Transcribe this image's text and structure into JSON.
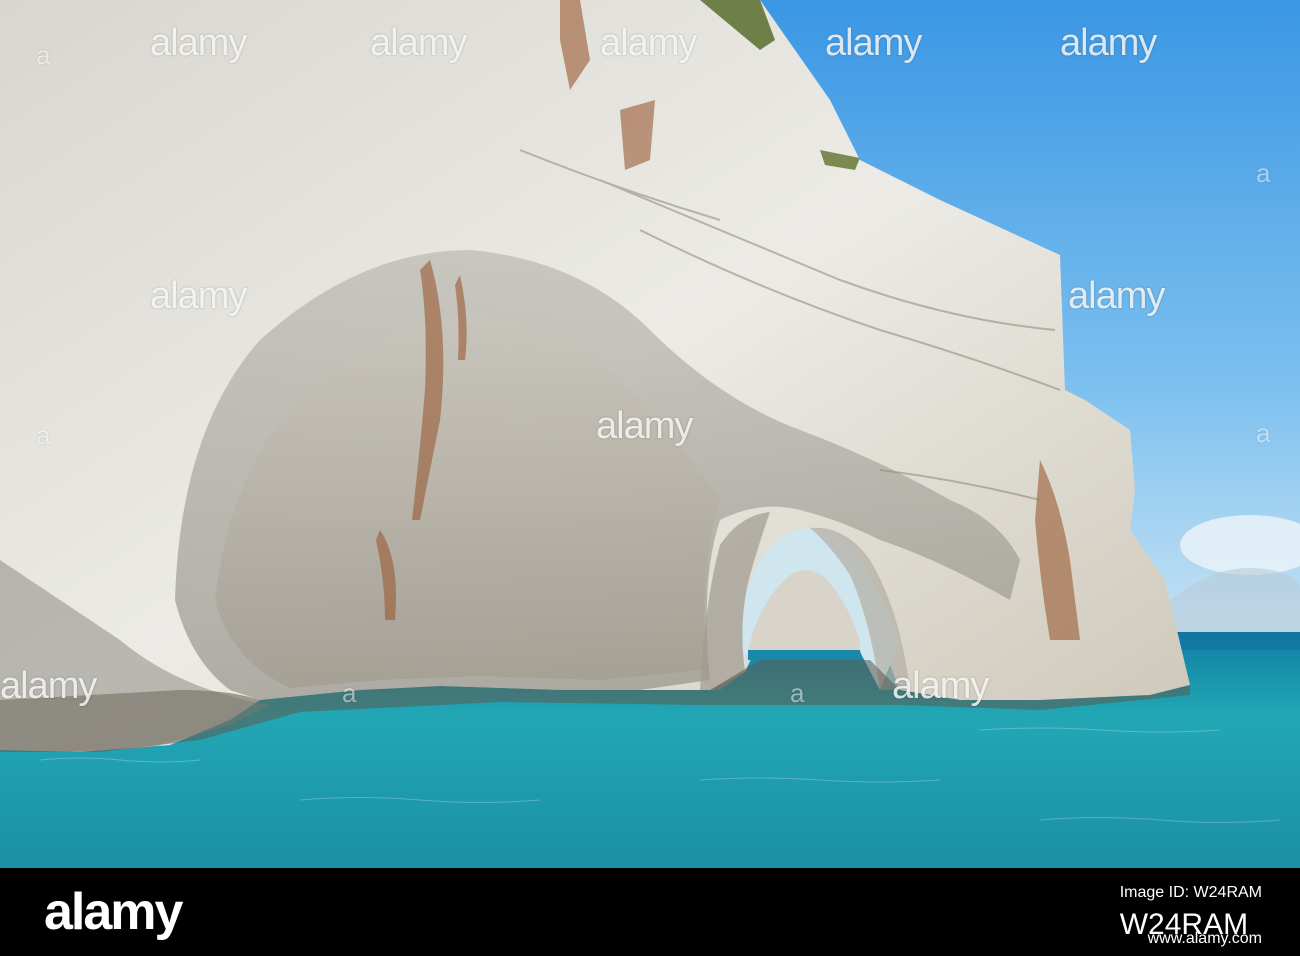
{
  "photo": {
    "subject": "sea-cave-arches",
    "sky_color": "#6fb6ea",
    "sea_color": "#1fa9b6",
    "rock_color": "#e6e3da"
  },
  "watermark": {
    "text": "alamy"
  },
  "footer": {
    "logo_text": "alamy",
    "id_label": "Image ID: W24RAM",
    "id_value": "W24RAM",
    "url": "www.alamy.com"
  }
}
